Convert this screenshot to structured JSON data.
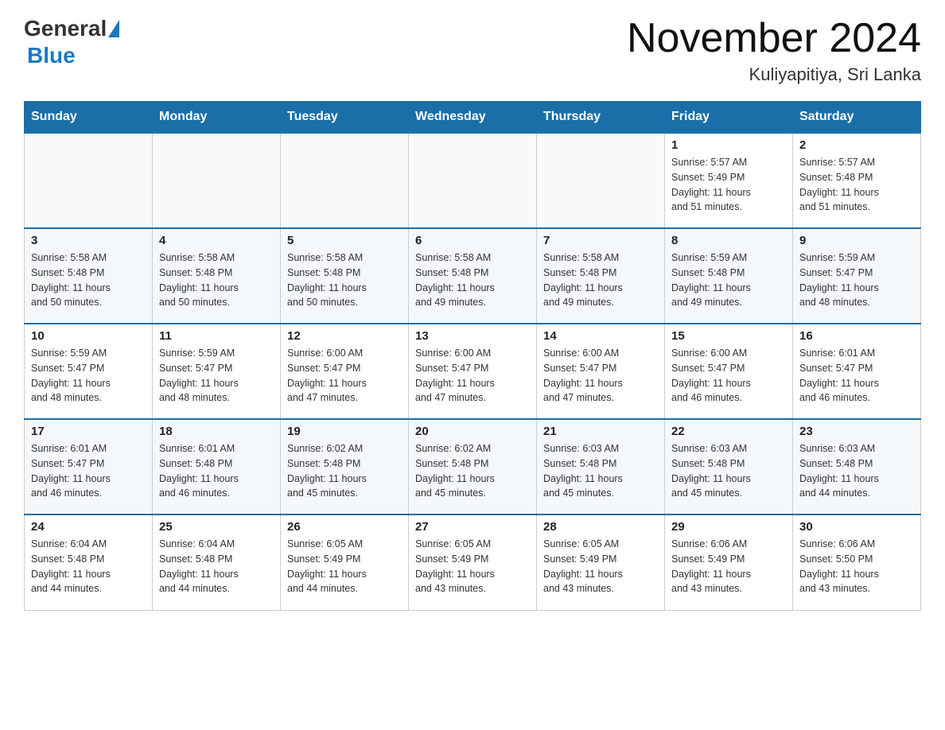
{
  "header": {
    "logo": {
      "general": "General",
      "blue": "Blue"
    },
    "title": "November 2024",
    "subtitle": "Kuliyapitiya, Sri Lanka"
  },
  "days_of_week": [
    "Sunday",
    "Monday",
    "Tuesday",
    "Wednesday",
    "Thursday",
    "Friday",
    "Saturday"
  ],
  "weeks": [
    [
      {
        "day": "",
        "info": ""
      },
      {
        "day": "",
        "info": ""
      },
      {
        "day": "",
        "info": ""
      },
      {
        "day": "",
        "info": ""
      },
      {
        "day": "",
        "info": ""
      },
      {
        "day": "1",
        "info": "Sunrise: 5:57 AM\nSunset: 5:49 PM\nDaylight: 11 hours\nand 51 minutes."
      },
      {
        "day": "2",
        "info": "Sunrise: 5:57 AM\nSunset: 5:48 PM\nDaylight: 11 hours\nand 51 minutes."
      }
    ],
    [
      {
        "day": "3",
        "info": "Sunrise: 5:58 AM\nSunset: 5:48 PM\nDaylight: 11 hours\nand 50 minutes."
      },
      {
        "day": "4",
        "info": "Sunrise: 5:58 AM\nSunset: 5:48 PM\nDaylight: 11 hours\nand 50 minutes."
      },
      {
        "day": "5",
        "info": "Sunrise: 5:58 AM\nSunset: 5:48 PM\nDaylight: 11 hours\nand 50 minutes."
      },
      {
        "day": "6",
        "info": "Sunrise: 5:58 AM\nSunset: 5:48 PM\nDaylight: 11 hours\nand 49 minutes."
      },
      {
        "day": "7",
        "info": "Sunrise: 5:58 AM\nSunset: 5:48 PM\nDaylight: 11 hours\nand 49 minutes."
      },
      {
        "day": "8",
        "info": "Sunrise: 5:59 AM\nSunset: 5:48 PM\nDaylight: 11 hours\nand 49 minutes."
      },
      {
        "day": "9",
        "info": "Sunrise: 5:59 AM\nSunset: 5:47 PM\nDaylight: 11 hours\nand 48 minutes."
      }
    ],
    [
      {
        "day": "10",
        "info": "Sunrise: 5:59 AM\nSunset: 5:47 PM\nDaylight: 11 hours\nand 48 minutes."
      },
      {
        "day": "11",
        "info": "Sunrise: 5:59 AM\nSunset: 5:47 PM\nDaylight: 11 hours\nand 48 minutes."
      },
      {
        "day": "12",
        "info": "Sunrise: 6:00 AM\nSunset: 5:47 PM\nDaylight: 11 hours\nand 47 minutes."
      },
      {
        "day": "13",
        "info": "Sunrise: 6:00 AM\nSunset: 5:47 PM\nDaylight: 11 hours\nand 47 minutes."
      },
      {
        "day": "14",
        "info": "Sunrise: 6:00 AM\nSunset: 5:47 PM\nDaylight: 11 hours\nand 47 minutes."
      },
      {
        "day": "15",
        "info": "Sunrise: 6:00 AM\nSunset: 5:47 PM\nDaylight: 11 hours\nand 46 minutes."
      },
      {
        "day": "16",
        "info": "Sunrise: 6:01 AM\nSunset: 5:47 PM\nDaylight: 11 hours\nand 46 minutes."
      }
    ],
    [
      {
        "day": "17",
        "info": "Sunrise: 6:01 AM\nSunset: 5:47 PM\nDaylight: 11 hours\nand 46 minutes."
      },
      {
        "day": "18",
        "info": "Sunrise: 6:01 AM\nSunset: 5:48 PM\nDaylight: 11 hours\nand 46 minutes."
      },
      {
        "day": "19",
        "info": "Sunrise: 6:02 AM\nSunset: 5:48 PM\nDaylight: 11 hours\nand 45 minutes."
      },
      {
        "day": "20",
        "info": "Sunrise: 6:02 AM\nSunset: 5:48 PM\nDaylight: 11 hours\nand 45 minutes."
      },
      {
        "day": "21",
        "info": "Sunrise: 6:03 AM\nSunset: 5:48 PM\nDaylight: 11 hours\nand 45 minutes."
      },
      {
        "day": "22",
        "info": "Sunrise: 6:03 AM\nSunset: 5:48 PM\nDaylight: 11 hours\nand 45 minutes."
      },
      {
        "day": "23",
        "info": "Sunrise: 6:03 AM\nSunset: 5:48 PM\nDaylight: 11 hours\nand 44 minutes."
      }
    ],
    [
      {
        "day": "24",
        "info": "Sunrise: 6:04 AM\nSunset: 5:48 PM\nDaylight: 11 hours\nand 44 minutes."
      },
      {
        "day": "25",
        "info": "Sunrise: 6:04 AM\nSunset: 5:48 PM\nDaylight: 11 hours\nand 44 minutes."
      },
      {
        "day": "26",
        "info": "Sunrise: 6:05 AM\nSunset: 5:49 PM\nDaylight: 11 hours\nand 44 minutes."
      },
      {
        "day": "27",
        "info": "Sunrise: 6:05 AM\nSunset: 5:49 PM\nDaylight: 11 hours\nand 43 minutes."
      },
      {
        "day": "28",
        "info": "Sunrise: 6:05 AM\nSunset: 5:49 PM\nDaylight: 11 hours\nand 43 minutes."
      },
      {
        "day": "29",
        "info": "Sunrise: 6:06 AM\nSunset: 5:49 PM\nDaylight: 11 hours\nand 43 minutes."
      },
      {
        "day": "30",
        "info": "Sunrise: 6:06 AM\nSunset: 5:50 PM\nDaylight: 11 hours\nand 43 minutes."
      }
    ]
  ]
}
